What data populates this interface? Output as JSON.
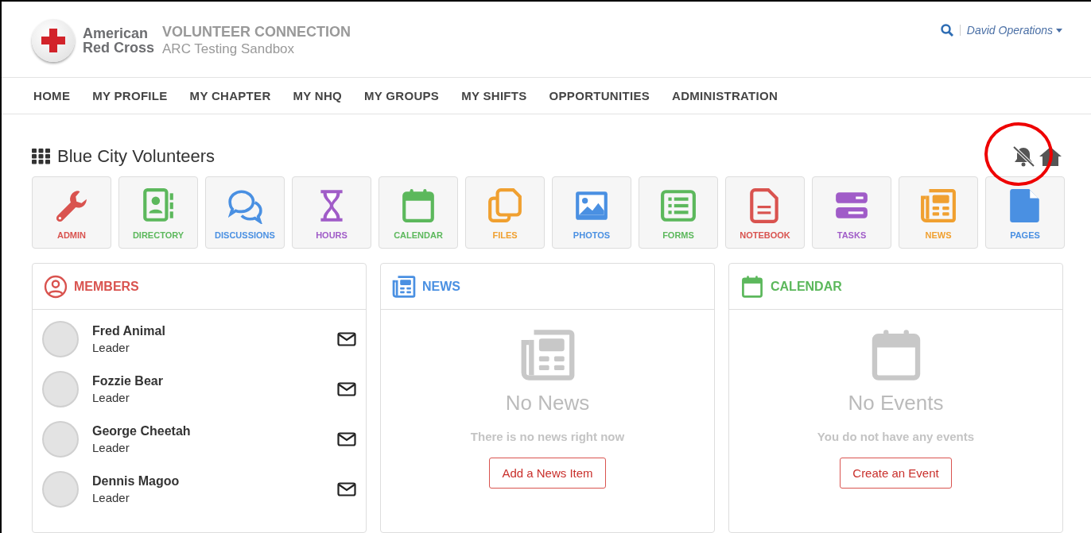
{
  "brand": {
    "logo_line1": "American",
    "logo_line2": "Red Cross",
    "product": "VOLUNTEER CONNECTION",
    "site": "ARC Testing Sandbox"
  },
  "user_menu": {
    "name": "David Operations"
  },
  "nav": [
    {
      "label": "HOME"
    },
    {
      "label": "MY PROFILE"
    },
    {
      "label": "MY CHAPTER"
    },
    {
      "label": "MY NHQ"
    },
    {
      "label": "MY GROUPS"
    },
    {
      "label": "MY SHIFTS"
    },
    {
      "label": "OPPORTUNITIES"
    },
    {
      "label": "ADMINISTRATION"
    }
  ],
  "group": {
    "title": "Blue City Volunteers",
    "notifications_muted": true,
    "highlight_circle": true
  },
  "tiles": [
    {
      "label": "ADMIN",
      "kind": "wrench",
      "color": "#d9534f"
    },
    {
      "label": "DIRECTORY",
      "kind": "directory",
      "color": "#5cb85c"
    },
    {
      "label": "DISCUSSIONS",
      "kind": "discussions",
      "color": "#4a90e2"
    },
    {
      "label": "HOURS",
      "kind": "hourglass",
      "color": "#a05cc8"
    },
    {
      "label": "CALENDAR",
      "kind": "calendar",
      "color": "#5cb85c"
    },
    {
      "label": "FILES",
      "kind": "files",
      "color": "#f0a030"
    },
    {
      "label": "PHOTOS",
      "kind": "photos",
      "color": "#4a90e2"
    },
    {
      "label": "FORMS",
      "kind": "forms",
      "color": "#5cb85c"
    },
    {
      "label": "NOTEBOOK",
      "kind": "notebook",
      "color": "#d9534f"
    },
    {
      "label": "TASKS",
      "kind": "tasks",
      "color": "#a05cc8"
    },
    {
      "label": "NEWS",
      "kind": "news",
      "color": "#f0a030"
    },
    {
      "label": "PAGES",
      "kind": "pages",
      "color": "#4a90e2"
    }
  ],
  "panels": [
    {
      "kind": "members",
      "title": "MEMBERS",
      "color": "#d9534f",
      "members": [
        {
          "name": "Fred Animal",
          "role": "Leader"
        },
        {
          "name": "Fozzie Bear",
          "role": "Leader"
        },
        {
          "name": "George Cheetah",
          "role": "Leader"
        },
        {
          "name": "Dennis Magoo",
          "role": "Leader"
        }
      ]
    },
    {
      "kind": "news",
      "title": "NEWS",
      "color": "#4a90e2",
      "empty_title": "No News",
      "empty_text": "There is no news right now",
      "button": "Add a News Item"
    },
    {
      "kind": "calendar",
      "title": "CALENDAR",
      "color": "#5cb85c",
      "empty_title": "No Events",
      "empty_text": "You do not have any events",
      "button": "Create an Event"
    }
  ]
}
